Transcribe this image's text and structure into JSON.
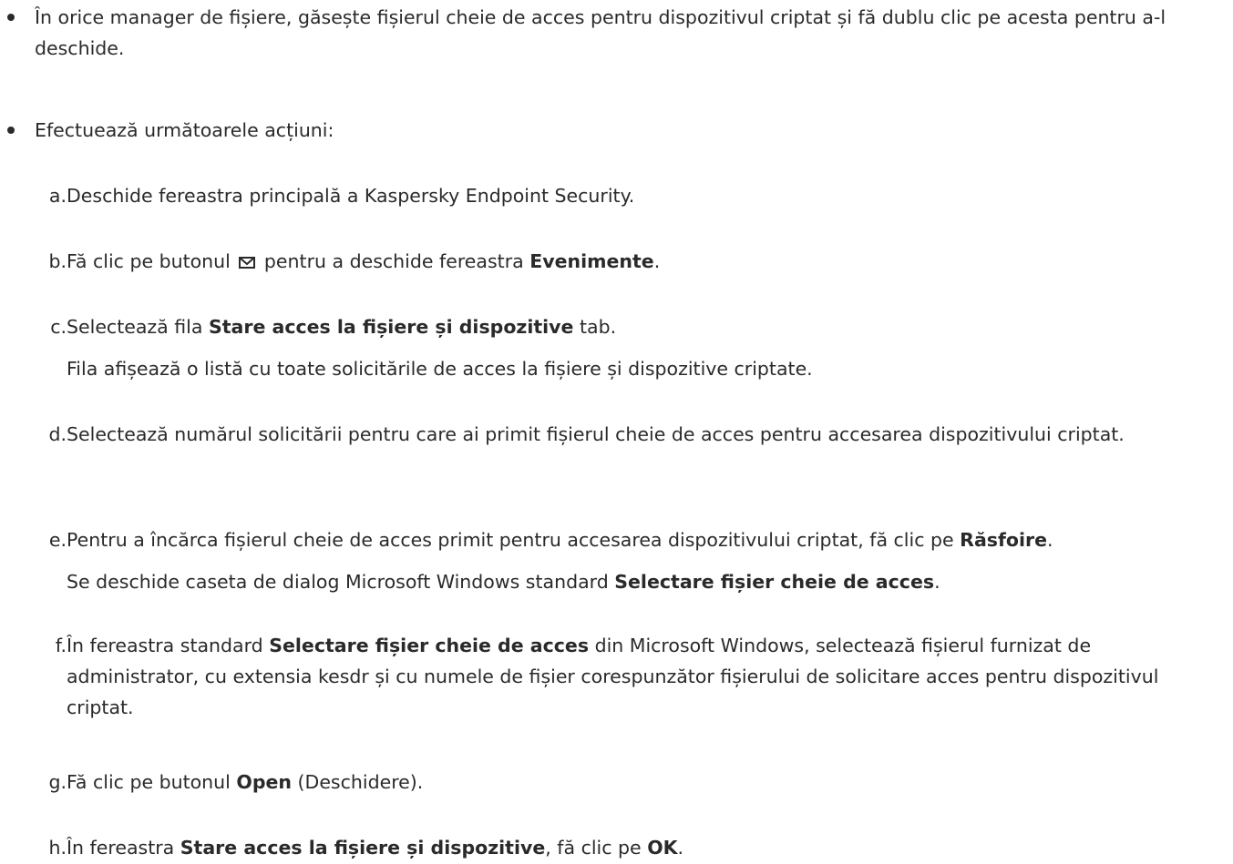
{
  "bullets": [
    {
      "text": "În orice manager de fișiere, găsește fișierul cheie de acces pentru dispozitivul criptat și fă dublu clic pe acesta pentru a-l deschide."
    },
    {
      "text": "Efectuează următoarele acțiuni:"
    }
  ],
  "steps": {
    "a": {
      "letter": "a.",
      "text": "Deschide fereastra principală a Kaspersky Endpoint Security."
    },
    "b": {
      "letter": "b.",
      "before": "Fă clic pe butonul",
      "icon": "envelope-icon",
      "middle": "pentru a deschide fereastra",
      "bold": "Evenimente",
      "after": "."
    },
    "c": {
      "letter": "c.",
      "before": "Selectează fila",
      "bold": "Stare acces la fișiere și dispozitive",
      "after": "tab.",
      "note": "Fila afișează o listă cu toate solicitările de acces la fișiere și dispozitive criptate."
    },
    "d": {
      "letter": "d.",
      "text": "Selectează numărul solicitării pentru care ai primit fișierul cheie de acces pentru accesarea dispozitivului criptat."
    },
    "e": {
      "letter": "e.",
      "before": "Pentru a încărca fișierul cheie de acces primit pentru accesarea dispozitivului criptat, fă clic pe",
      "bold": "Răsfoire",
      "after": ".",
      "note_before": "Se deschide caseta de dialog Microsoft Windows standard",
      "note_bold": "Selectare fișier cheie de acces",
      "note_after": "."
    },
    "f": {
      "letter": "f.",
      "before": "În fereastra standard",
      "bold": "Selectare fișier cheie de acces",
      "after": "din Microsoft Windows, selectează fișierul furnizat de administrator, cu extensia kesdr și cu numele de fișier corespunzător fișierului de solicitare acces pentru dispozitivul criptat."
    },
    "g": {
      "letter": "g.",
      "before": "Fă clic pe butonul",
      "bold": "Open",
      "after": "(Deschidere)."
    },
    "h": {
      "letter": "h.",
      "before": "În fereastra",
      "bold": "Stare acces la fișiere și dispozitive",
      "middle": ", fă clic pe",
      "bold2": "OK",
      "after": "."
    }
  }
}
